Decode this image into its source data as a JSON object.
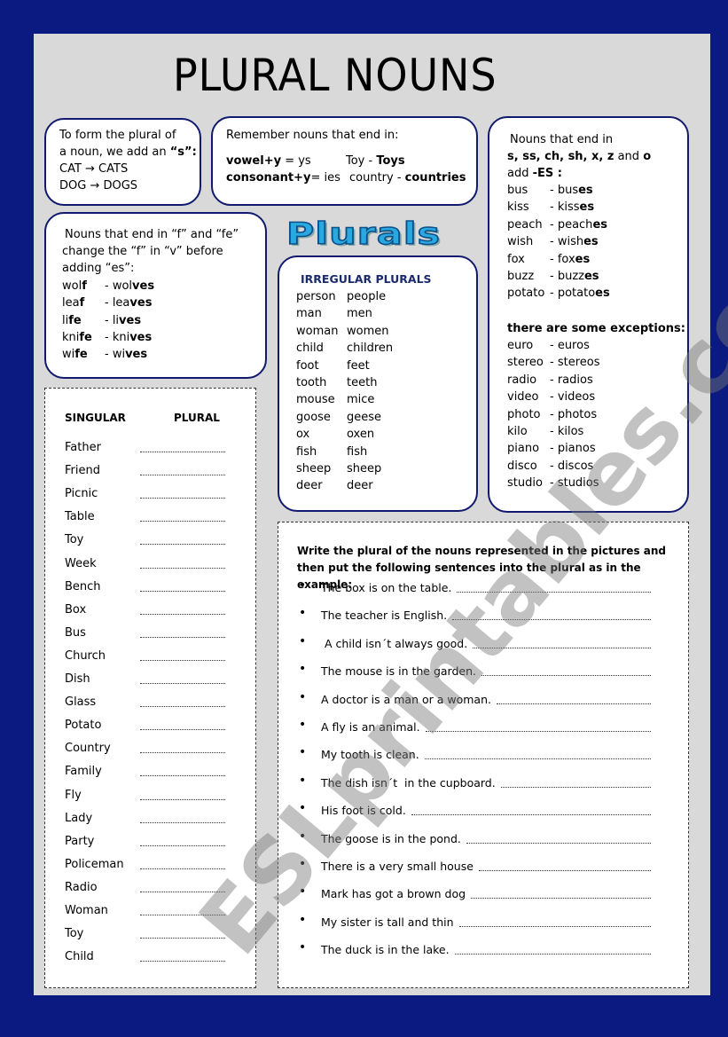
{
  "title": "PLURAL NOUNS",
  "logo": "Plurals",
  "watermark": "ESLprintables.com",
  "colors": {
    "background": "#0b1a80",
    "page": "#d9d9d9",
    "box_border": "#101a6e",
    "logo": "#29a9e0"
  },
  "rule_s": {
    "lines": [
      "To form the plural of",
      "a noun, we add an ",
      "“s”:",
      "CAT → CATS",
      "DOG → DOGS"
    ]
  },
  "rule_y": {
    "heading": "Remember nouns that end in:",
    "vowel_bold": "vowel+y",
    "vowel_rest": " = ys",
    "toy": "Toy - ",
    "toys": "Toys",
    "cons_bold": "consonant+y",
    "cons_rest": "= ies",
    "country": "country - ",
    "countries": "countries"
  },
  "rule_f": {
    "lines": [
      "Nouns that end in “f” and “fe”",
      "change the “f” in “v” before",
      "adding “es”:"
    ],
    "items": [
      {
        "s": "wol",
        "sb": "f",
        "p": "- wol",
        "pb": "ves"
      },
      {
        "s": "lea",
        "sb": "f",
        "p": "- lea",
        "pb": "ves"
      },
      {
        "s": "li",
        "sb": "fe",
        "p": "- li",
        "pb": "ves"
      },
      {
        "s": "kni",
        "sb": "fe",
        "p": "- kni",
        "pb": "ves"
      },
      {
        "s": "wi",
        "sb": "fe",
        "p": "- wi",
        "pb": "ves"
      }
    ]
  },
  "irregular": {
    "heading": "IRREGULAR PLURALS",
    "items": [
      [
        "person",
        "people"
      ],
      [
        "man",
        "men"
      ],
      [
        "woman",
        "women"
      ],
      [
        "child",
        "children"
      ],
      [
        "foot",
        "feet"
      ],
      [
        "tooth",
        "teeth"
      ],
      [
        "mouse",
        "mice"
      ],
      [
        "goose",
        "geese"
      ],
      [
        "ox",
        "oxen"
      ],
      [
        "fish",
        "fish"
      ],
      [
        "sheep",
        "sheep"
      ],
      [
        "deer",
        "deer"
      ]
    ]
  },
  "rule_es": {
    "line1": "Nouns that end in",
    "line2": "s, ss, ch, sh, x, z",
    "line2_and": " and ",
    "line2_o": "o",
    "line3": "add ",
    "line3_bold": "-ES :",
    "items": [
      {
        "s": "bus",
        "p": "- bus",
        "pb": "es"
      },
      {
        "s": "kiss",
        "p": "- kiss",
        "pb": "es"
      },
      {
        "s": "peach",
        "p": "- peach",
        "pb": "es"
      },
      {
        "s": "wish",
        "p": "- wish",
        "pb": "es"
      },
      {
        "s": "fox",
        "p": "- fox",
        "pb": "es"
      },
      {
        "s": "buzz",
        "p": "- buzz",
        "pb": "es"
      },
      {
        "s": "potato",
        "p": "- potato",
        "pb": "es"
      }
    ],
    "exceptions_heading": "there are some exceptions:",
    "exceptions": [
      [
        "euro",
        "- euros"
      ],
      [
        "stereo",
        "- stereos"
      ],
      [
        "radio",
        "- radios"
      ],
      [
        "video",
        "- videos"
      ],
      [
        "photo",
        "- photos"
      ],
      [
        "kilo",
        "- kilos"
      ],
      [
        "piano",
        "- pianos"
      ],
      [
        "disco",
        "- discos"
      ],
      [
        "studio",
        "- studios"
      ]
    ]
  },
  "exercise1": {
    "col_singular": "SINGULAR",
    "col_plural": "PLURAL",
    "words": [
      "Father",
      "Friend",
      "Picnic",
      "Table",
      "Toy",
      "Week",
      "Bench",
      "Box",
      "Bus",
      "Church",
      "Dish",
      "Glass",
      "Potato",
      "Country",
      "Family",
      "Fly",
      "Lady",
      "Party",
      "Policeman",
      "Radio",
      "Woman",
      "Toy",
      "Child"
    ]
  },
  "exercise2": {
    "instruction": "Write the plural of the nouns represented in the pictures and then put the following sentences into the plural as in the example:",
    "sentences": [
      "The box is on the table.",
      "The teacher is English.",
      " A child isn´t always good.",
      "The mouse is in the garden.",
      "A doctor is a man or a woman.",
      "A fly is an animal.",
      "My tooth is clean.",
      "The dish isn´t  in the cupboard.",
      "His foot is cold.",
      "The goose is in the pond.",
      "There is a very small house",
      "Mark has got a brown dog",
      "My sister is tall and thin",
      "The duck is in the lake."
    ]
  }
}
